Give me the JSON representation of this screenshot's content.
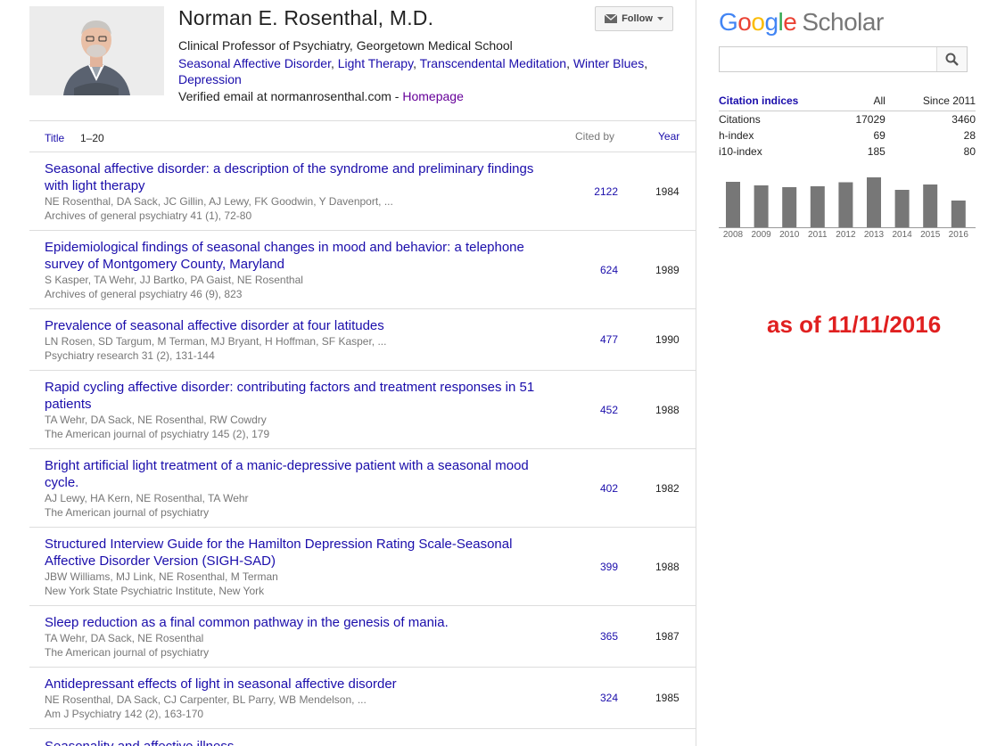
{
  "profile": {
    "name": "Norman E. Rosenthal, M.D.",
    "affiliation": "Clinical Professor of Psychiatry, Georgetown Medical School",
    "interests": [
      "Seasonal Affective Disorder",
      "Light Therapy",
      "Transcendental Meditation",
      "Winter Blues",
      "Depression"
    ],
    "email_text": "Verified email at normanrosenthal.com",
    "email_sep": " - ",
    "homepage_label": "Homepage",
    "follow_label": "Follow",
    "follow_icon": "envelope-icon"
  },
  "table": {
    "title_label": "Title",
    "range_label": "1–20",
    "cited_by_label": "Cited by",
    "year_label": "Year"
  },
  "articles": [
    {
      "title": "Seasonal affective disorder: a description of the syndrome and preliminary findings with light therapy",
      "authors": "NE Rosenthal, DA Sack, JC Gillin, AJ Lewy, FK Goodwin, Y Davenport, ...",
      "venue": "Archives of general psychiatry 41 (1), 72-80",
      "cited_by": "2122",
      "year": "1984"
    },
    {
      "title": "Epidemiological findings of seasonal changes in mood and behavior: a telephone survey of Montgomery County, Maryland",
      "authors": "S Kasper, TA Wehr, JJ Bartko, PA Gaist, NE Rosenthal",
      "venue": "Archives of general psychiatry 46 (9), 823",
      "cited_by": "624",
      "year": "1989"
    },
    {
      "title": "Prevalence of seasonal affective disorder at four latitudes",
      "authors": "LN Rosen, SD Targum, M Terman, MJ Bryant, H Hoffman, SF Kasper, ...",
      "venue": "Psychiatry research 31 (2), 131-144",
      "cited_by": "477",
      "year": "1990"
    },
    {
      "title": "Rapid cycling affective disorder: contributing factors and treatment responses in 51 patients",
      "authors": "TA Wehr, DA Sack, NE Rosenthal, RW Cowdry",
      "venue": "The American journal of psychiatry 145 (2), 179",
      "cited_by": "452",
      "year": "1988"
    },
    {
      "title": "Bright artificial light treatment of a manic-depressive patient with a seasonal mood cycle.",
      "authors": "AJ Lewy, HA Kern, NE Rosenthal, TA Wehr",
      "venue": "The American journal of psychiatry",
      "cited_by": "402",
      "year": "1982"
    },
    {
      "title": "Structured Interview Guide for the Hamilton Depression Rating Scale-Seasonal Affective Disorder Version (SIGH-SAD)",
      "authors": "JBW Williams, MJ Link, NE Rosenthal, M Terman",
      "venue": "New York State Psychiatric Institute, New York",
      "cited_by": "399",
      "year": "1988"
    },
    {
      "title": "Sleep reduction as a final common pathway in the genesis of mania.",
      "authors": "TA Wehr, DA Sack, NE Rosenthal",
      "venue": "The American journal of psychiatry",
      "cited_by": "365",
      "year": "1987"
    },
    {
      "title": "Antidepressant effects of light in seasonal affective disorder",
      "authors": "NE Rosenthal, DA Sack, CJ Carpenter, BL Parry, WB Mendelson, ...",
      "venue": "Am J Psychiatry 142 (2), 163-170",
      "cited_by": "324",
      "year": "1985"
    },
    {
      "title": "Seasonality and affective illness",
      "authors": "",
      "venue": "",
      "cited_by": "",
      "year": ""
    }
  ],
  "sidebar": {
    "logo_google": [
      "G",
      "o",
      "o",
      "g",
      "l",
      "e"
    ],
    "logo_scholar": "Scholar",
    "search_placeholder": "",
    "search_icon": "search-icon",
    "citation_header": [
      "Citation indices",
      "All",
      "Since 2011"
    ],
    "citation_rows": [
      [
        "Citations",
        "17029",
        "3460"
      ],
      [
        "h-index",
        "69",
        "28"
      ],
      [
        "i10-index",
        "185",
        "80"
      ]
    ]
  },
  "chart_data": {
    "type": "bar",
    "categories": [
      "2008",
      "2009",
      "2010",
      "2011",
      "2012",
      "2013",
      "2014",
      "2015",
      "2016"
    ],
    "values": [
      510,
      470,
      450,
      460,
      505,
      560,
      420,
      480,
      300
    ],
    "bar_color": "#777777"
  },
  "annotation": {
    "as_of": "as of 11/11/2016",
    "color": "#e02020"
  },
  "colors": {
    "link": "#1a0dab",
    "visited": "#660099",
    "muted": "#777777"
  }
}
